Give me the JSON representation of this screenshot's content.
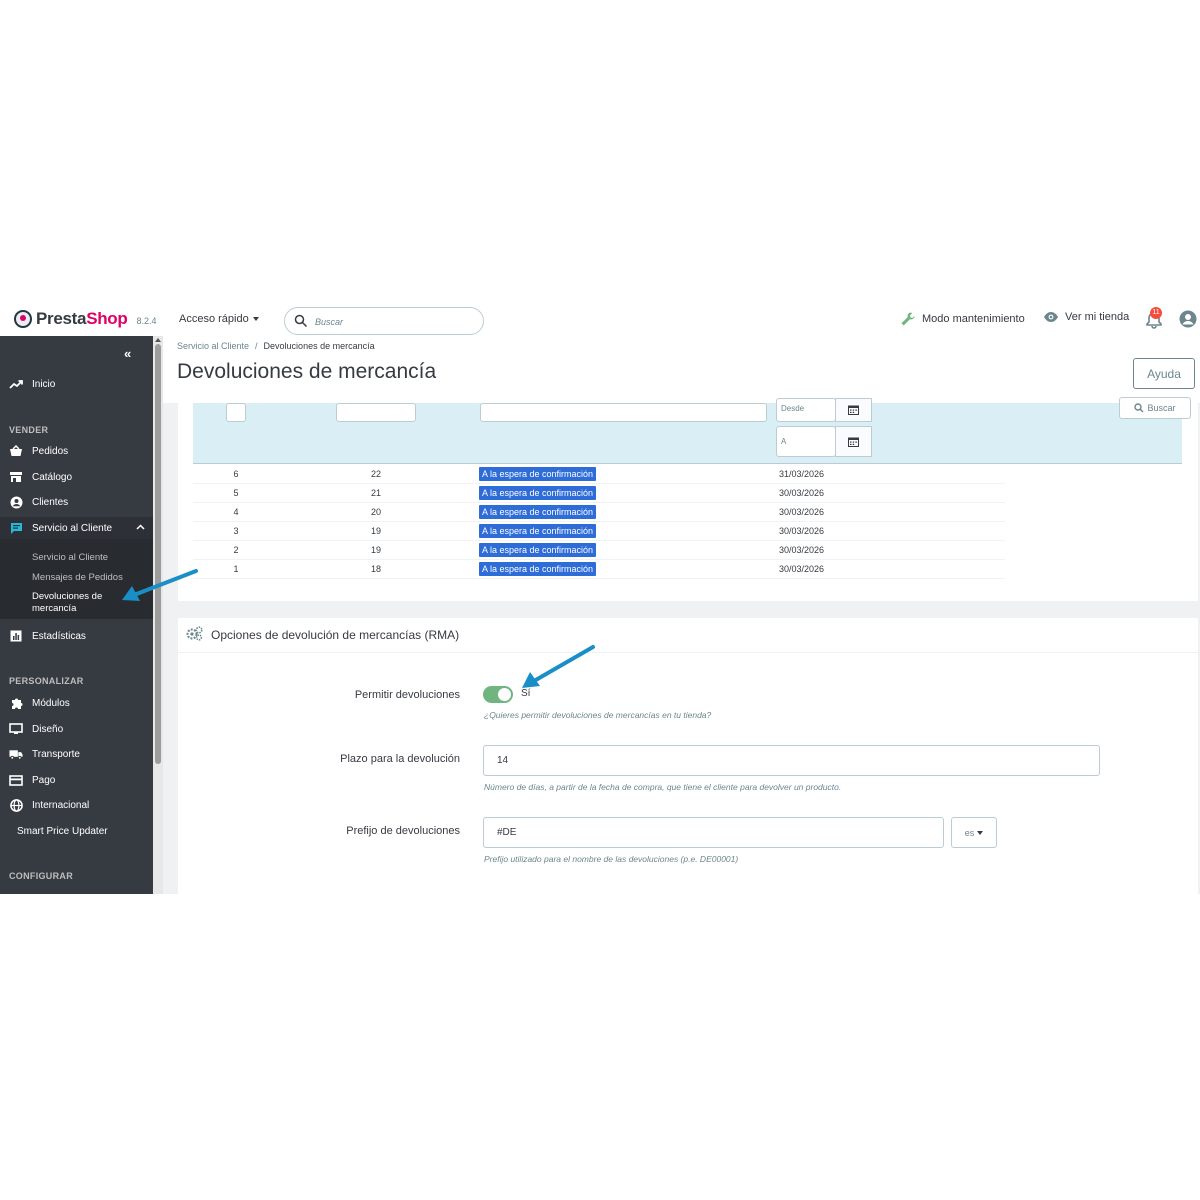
{
  "header": {
    "logo_presta": "Presta",
    "logo_shop": "Shop",
    "version": "8.2.4",
    "quick_access": "Acceso rápido",
    "search_placeholder": "Buscar",
    "maintenance": "Modo mantenimiento",
    "view_shop": "Ver mi tienda",
    "notifications_count": "11"
  },
  "sidebar": {
    "collapse_glyph": "«",
    "home": "Inicio",
    "section_sell": "VENDER",
    "orders": "Pedidos",
    "catalog": "Catálogo",
    "customers": "Clientes",
    "customer_service": "Servicio al Cliente",
    "sub_customer_service": "Servicio al Cliente",
    "sub_order_messages": "Mensajes de Pedidos",
    "sub_returns_line1": "Devoluciones de",
    "sub_returns_line2": "mercancía",
    "stats": "Estadísticas",
    "section_customize": "PERSONALIZAR",
    "modules": "Módulos",
    "design": "Diseño",
    "shipping": "Transporte",
    "payment": "Pago",
    "international": "Internacional",
    "smart_price": "Smart Price Updater",
    "section_configure": "CONFIGURAR"
  },
  "page": {
    "breadcrumb_parent": "Servicio al Cliente",
    "breadcrumb_sep": "/",
    "breadcrumb_current": "Devoluciones de mercancía",
    "title": "Devoluciones de mercancía",
    "help": "Ayuda"
  },
  "filters": {
    "date_from": "Desde",
    "date_to": "A",
    "search_btn": "Buscar"
  },
  "returns": [
    {
      "id": "6",
      "order": "22",
      "status": "A la espera de confirmación",
      "date": "31/03/2026"
    },
    {
      "id": "5",
      "order": "21",
      "status": "A la espera de confirmación",
      "date": "30/03/2026"
    },
    {
      "id": "4",
      "order": "20",
      "status": "A la espera de confirmación",
      "date": "30/03/2026"
    },
    {
      "id": "3",
      "order": "19",
      "status": "A la espera de confirmación",
      "date": "30/03/2026"
    },
    {
      "id": "2",
      "order": "19",
      "status": "A la espera de confirmación",
      "date": "30/03/2026"
    },
    {
      "id": "1",
      "order": "18",
      "status": "A la espera de confirmación",
      "date": "30/03/2026"
    }
  ],
  "rma": {
    "title": "Opciones de devolución de mercancías (RMA)",
    "allow_label": "Permitir devoluciones",
    "allow_value": "Sí",
    "allow_help": "¿Quieres permitir devoluciones de mercancías en tu tienda?",
    "period_label": "Plazo para la devolución",
    "period_value": "14",
    "period_help": "Número de días, a partir de la fecha de compra, que tiene el cliente para devolver un producto.",
    "prefix_label": "Prefijo de devoluciones",
    "prefix_value": "#DE",
    "prefix_lang": "es",
    "prefix_help": "Prefijo utilizado para el nombre de las devoluciones (p.e. DE00001)"
  },
  "colors": {
    "sidebar": "#363a41",
    "brand": "#df0067",
    "status_badge": "#2e6cd8",
    "toggle_on": "#70b580",
    "annotation_arrow": "#1a8fc7"
  }
}
